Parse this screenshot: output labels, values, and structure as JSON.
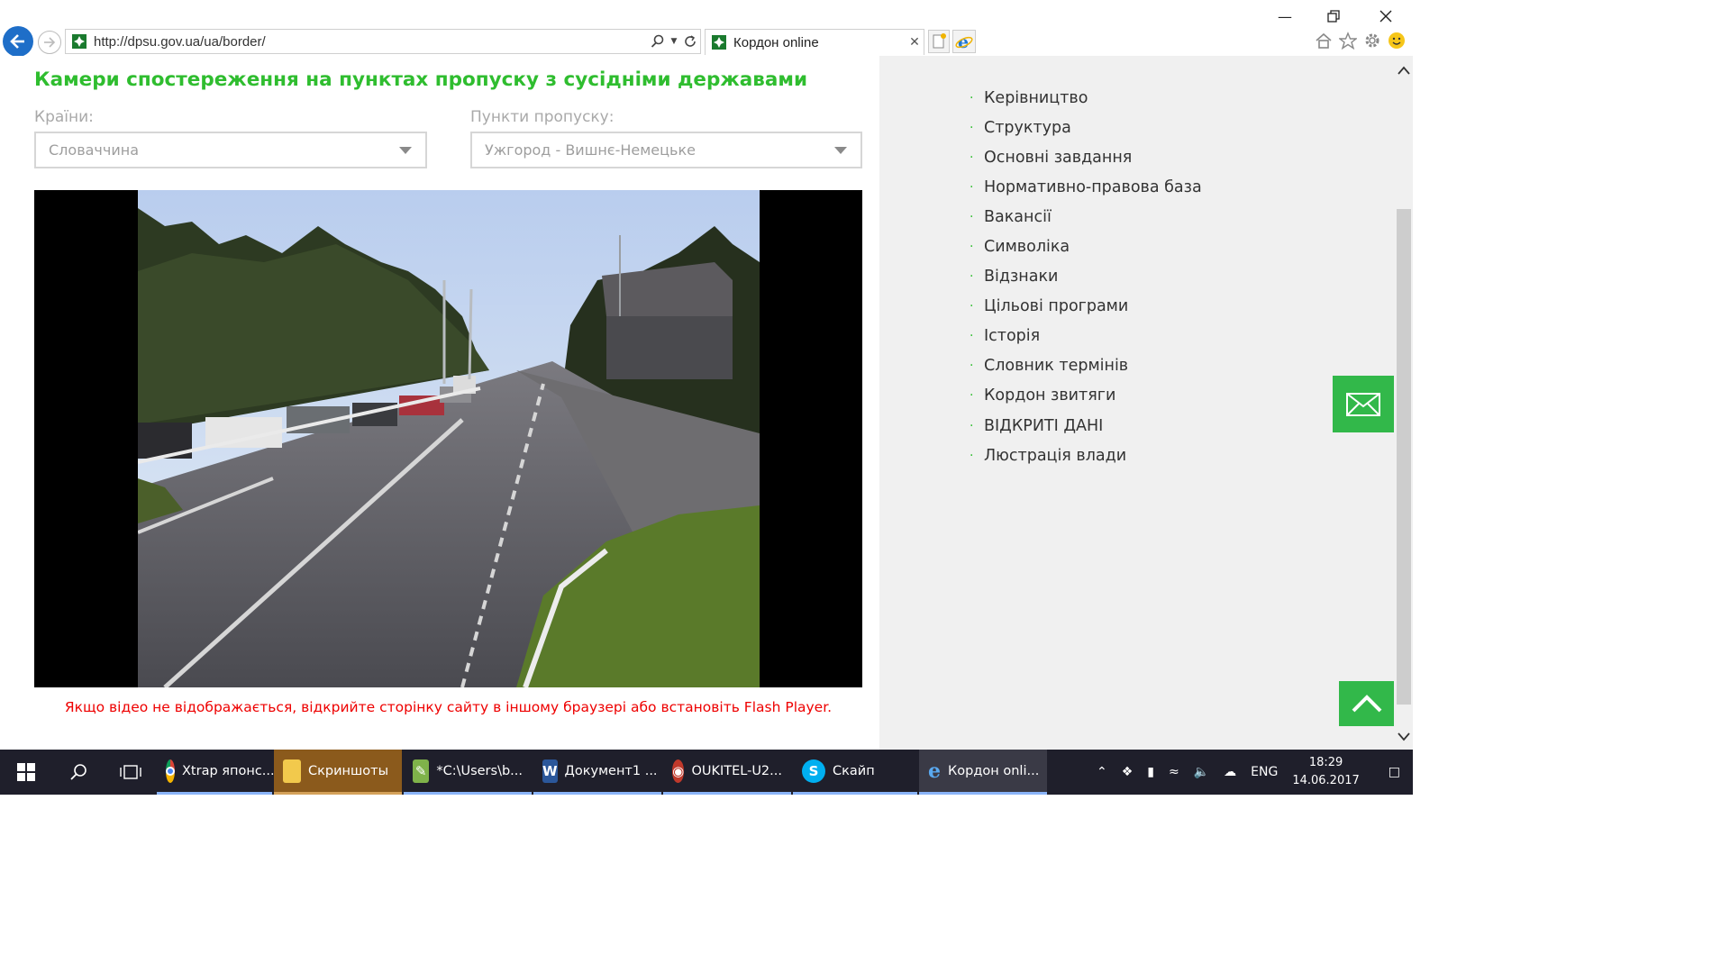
{
  "browser": {
    "url": "http://dpsu.gov.ua/ua/border/",
    "tab_title": "Кордон online"
  },
  "page": {
    "title": "Камери спостереження на пунктах пропуску з сусідніми державами",
    "country_label": "Країни:",
    "country_value": "Словаччина",
    "checkpoint_label": "Пункти пропуску:",
    "checkpoint_value": "Ужгород - Вишнє-Немецьке",
    "notice": "Якщо відео не відображається, відкрийте сторінку сайту в іншому браузері або встановіть Flash Player."
  },
  "sidebar": {
    "items": [
      {
        "label": "Керівництво"
      },
      {
        "label": "Структура"
      },
      {
        "label": "Основні завдання"
      },
      {
        "label": "Нормативно-правова база"
      },
      {
        "label": "Вакансії"
      },
      {
        "label": "Символіка"
      },
      {
        "label": "Відзнаки"
      },
      {
        "label": "Цільові програми"
      },
      {
        "label": "Історія"
      },
      {
        "label": "Словник термінів"
      },
      {
        "label": "Кордон звитяги"
      },
      {
        "label": "ВІДКРИТІ ДАНІ"
      },
      {
        "label": "Люстрація влади"
      }
    ]
  },
  "taskbar": {
    "apps": [
      {
        "label": "Xtrap японс..."
      },
      {
        "label": "Скриншоты"
      },
      {
        "label": "*C:\\Users\\b..."
      },
      {
        "label": "Документ1 ..."
      },
      {
        "label": "OUKITEL-U2..."
      },
      {
        "label": "Скайп"
      },
      {
        "label": "Кордон onli..."
      }
    ],
    "lang": "ENG",
    "time": "18:29",
    "date": "14.06.2017"
  },
  "colors": {
    "accent_green": "#2fbd2f",
    "button_green": "#32b84a",
    "notice_red": "#ee0000",
    "ie_blue": "#1e6ec8"
  }
}
